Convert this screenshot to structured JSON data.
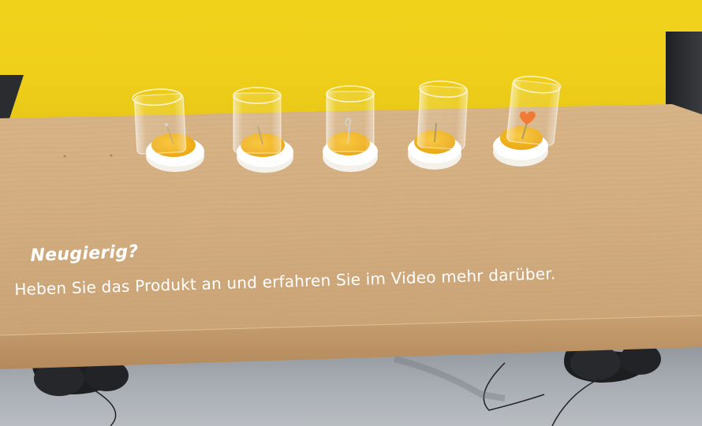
{
  "display": {
    "heading": "Neugierig?",
    "subtext": "Heben Sie das Produkt an und erfahren Sie im Video mehr darüber."
  },
  "colors": {
    "wall": "#f1d21b",
    "wood": "#d9b58a",
    "sample_yellow": "#f2b11a",
    "sample_orange": "#ef6a1c",
    "floor": "#a5aab0"
  },
  "samples": [
    {
      "name": "sample-1",
      "icon": "needle"
    },
    {
      "name": "sample-2",
      "icon": "needle"
    },
    {
      "name": "sample-3",
      "icon": "hook"
    },
    {
      "name": "sample-4",
      "icon": "needle"
    },
    {
      "name": "sample-5",
      "icon": "heart-charm"
    }
  ]
}
